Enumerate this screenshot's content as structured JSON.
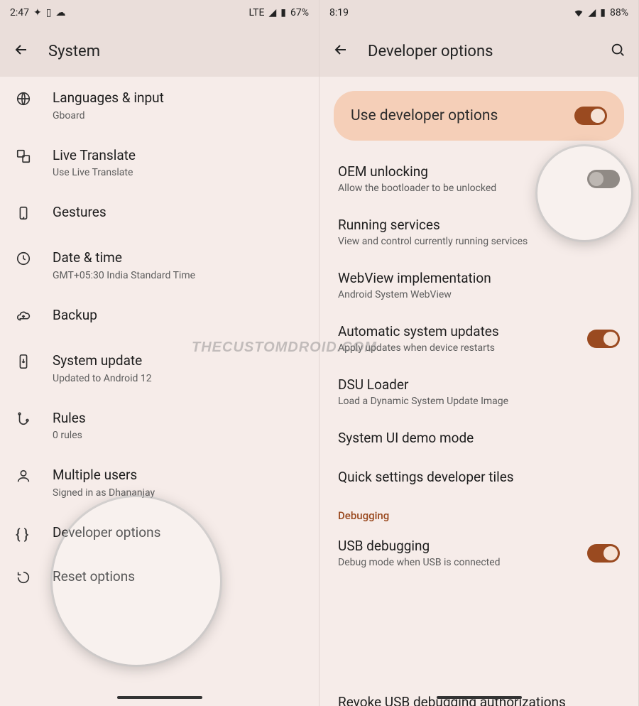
{
  "watermark": "THECUSTOMDROID.COM",
  "left": {
    "status": {
      "time": "2:47",
      "signal": "LTE",
      "battery": "67%"
    },
    "appbar": {
      "title": "System"
    },
    "items": [
      {
        "title": "Languages & input",
        "sub": "Gboard",
        "icon": "globe"
      },
      {
        "title": "Live Translate",
        "sub": "Use Live Translate",
        "icon": "translate"
      },
      {
        "title": "Gestures",
        "sub": "",
        "icon": "gesture"
      },
      {
        "title": "Date & time",
        "sub": "GMT+05:30 India Standard Time",
        "icon": "clock"
      },
      {
        "title": "Backup",
        "sub": "",
        "icon": "cloud"
      },
      {
        "title": "System update",
        "sub": "Updated to Android 12",
        "icon": "update-phone"
      },
      {
        "title": "Rules",
        "sub": "0 rules",
        "icon": "rules"
      },
      {
        "title": "Multiple users",
        "sub": "Signed in as Dhananjay",
        "icon": "person"
      },
      {
        "title": "Developer options",
        "sub": "",
        "icon": "braces"
      },
      {
        "title": "Reset options",
        "sub": "",
        "icon": "reset"
      }
    ]
  },
  "right": {
    "status": {
      "time": "8:19",
      "battery": "88%"
    },
    "appbar": {
      "title": "Developer options"
    },
    "hero": {
      "title": "Use developer options",
      "toggle": true
    },
    "items": [
      {
        "title": "OEM unlocking",
        "sub": "Allow the bootloader to be unlocked",
        "toggle": false
      },
      {
        "title": "Running services",
        "sub": "View and control currently running services"
      },
      {
        "title": "WebView implementation",
        "sub": "Android System WebView"
      },
      {
        "title": "Automatic system updates",
        "sub": "Apply updates when device restarts",
        "toggle": true
      },
      {
        "title": "DSU Loader",
        "sub": "Load a Dynamic System Update Image"
      },
      {
        "title": "System UI demo mode",
        "sub": ""
      },
      {
        "title": "Quick settings developer tiles",
        "sub": ""
      }
    ],
    "section": "Debugging",
    "usb": {
      "title": "USB debugging",
      "sub": "Debug mode when USB is connected",
      "toggle": true
    },
    "revoke": {
      "title": "Revoke USB debugging authorizations"
    }
  }
}
